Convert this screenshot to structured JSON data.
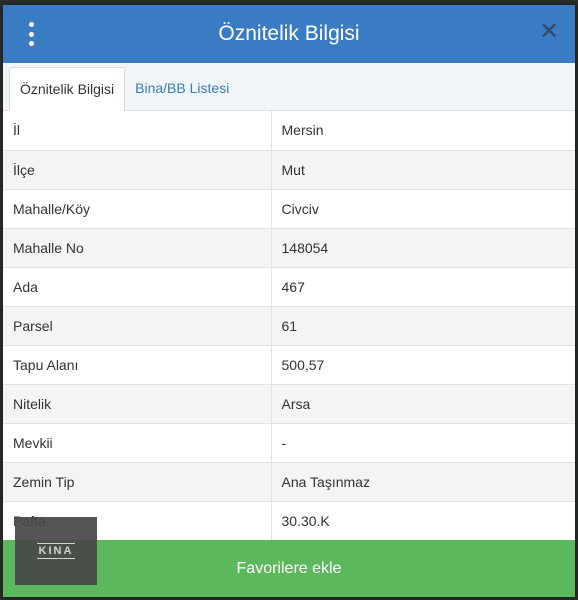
{
  "background_id": "#1223421954",
  "modal": {
    "title": "Öznitelik Bilgisi",
    "close_symbol": "✕",
    "menu_icon": "kebab-vertical-icon"
  },
  "tabs": [
    {
      "label": "Öznitelik Bilgisi",
      "active": true
    },
    {
      "label": "Bina/BB Listesi",
      "active": false
    }
  ],
  "attributes": [
    {
      "key": "İl",
      "value": "Mersin"
    },
    {
      "key": "İlçe",
      "value": "Mut"
    },
    {
      "key": "Mahalle/Köy",
      "value": "Civciv"
    },
    {
      "key": "Mahalle No",
      "value": "148054"
    },
    {
      "key": "Ada",
      "value": "467"
    },
    {
      "key": "Parsel",
      "value": "61"
    },
    {
      "key": "Tapu Alanı",
      "value": "500,57"
    },
    {
      "key": "Nitelik",
      "value": "Arsa"
    },
    {
      "key": "Mevkii",
      "value": "-"
    },
    {
      "key": "Zemin Tip",
      "value": "Ana Taşınmaz"
    },
    {
      "key": "Pafta",
      "value": "30.30.K"
    }
  ],
  "footer": {
    "button_label": "Favorilere ekle"
  },
  "logo": {
    "text": "KINA"
  },
  "colors": {
    "header": "#3a7cc3",
    "footer": "#5cb85c",
    "tab_link": "#3a7cc3"
  }
}
